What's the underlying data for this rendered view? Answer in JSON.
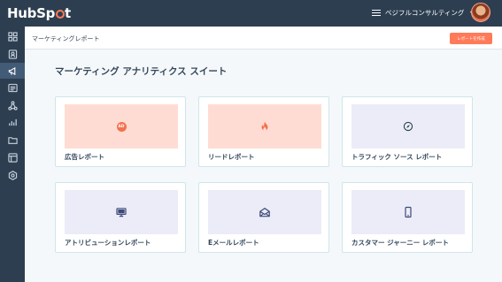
{
  "app": {
    "logo": {
      "prefix": "HubSp",
      "suffix": "t"
    },
    "account": {
      "name": "ベジフルコンサルティング"
    }
  },
  "subheader": {
    "breadcrumb": "マーケティングレポート",
    "create_button": "レポートを作成"
  },
  "main": {
    "title": "マーケティング アナリティクス スイート",
    "cards": [
      {
        "label": "広告レポート",
        "icon": "ad-icon",
        "badge": "AD",
        "thumb_color": "#ffdcd3"
      },
      {
        "label": "リードレポート",
        "icon": "flame-icon",
        "thumb_color": "#ffdcd3"
      },
      {
        "label": "トラフィック ソース レポート",
        "icon": "compass-icon",
        "thumb_color": "#ebecf7"
      },
      {
        "label": "アトリビューションレポート",
        "icon": "monitor-icon",
        "thumb_color": "#ebecf7"
      },
      {
        "label": "Eメールレポート",
        "icon": "email-icon",
        "thumb_color": "#ebecf7"
      },
      {
        "label": "カスタマー ジャーニー レポート",
        "icon": "mobile-icon",
        "thumb_color": "#ebecf7"
      }
    ]
  },
  "sidebar": {
    "items": [
      {
        "icon": "dashboard-icon"
      },
      {
        "icon": "contacts-icon"
      },
      {
        "icon": "marketing-icon",
        "active": true
      },
      {
        "icon": "sales-icon"
      },
      {
        "icon": "workflows-icon"
      },
      {
        "icon": "reports-icon"
      },
      {
        "icon": "files-icon"
      },
      {
        "icon": "content-icon"
      },
      {
        "icon": "settings-icon"
      }
    ]
  },
  "colors": {
    "topbar": "#2d3e50",
    "accent": "#ff7a59",
    "sidebar_active": "#425b76",
    "card_border": "#cfe5ec"
  }
}
